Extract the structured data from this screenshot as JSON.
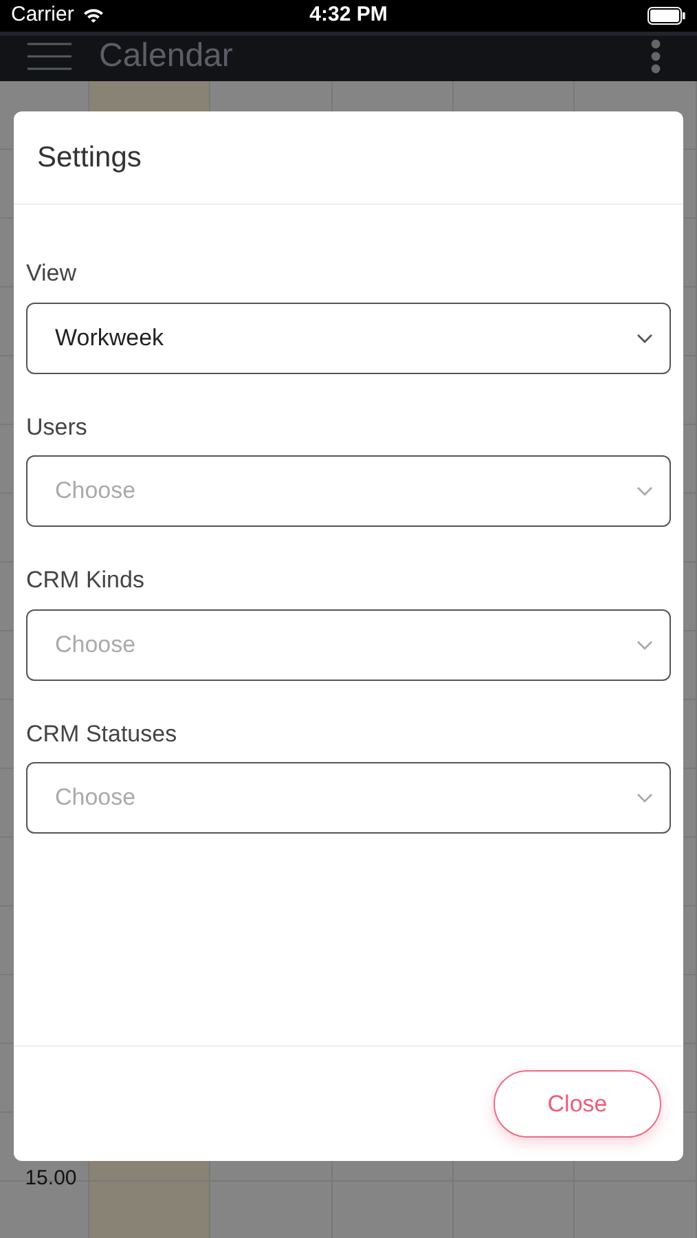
{
  "status_bar": {
    "carrier": "Carrier",
    "time": "4:32 PM"
  },
  "header": {
    "title": "Calendar"
  },
  "calendar": {
    "time_label": "15.00"
  },
  "dialog": {
    "title": "Settings",
    "fields": [
      {
        "label": "View",
        "value": "Workweek"
      },
      {
        "label": "Users",
        "placeholder": "Choose"
      },
      {
        "label": "CRM Kinds",
        "placeholder": "Choose"
      },
      {
        "label": "CRM Statuses",
        "placeholder": "Choose"
      }
    ],
    "close_button": "Close"
  }
}
